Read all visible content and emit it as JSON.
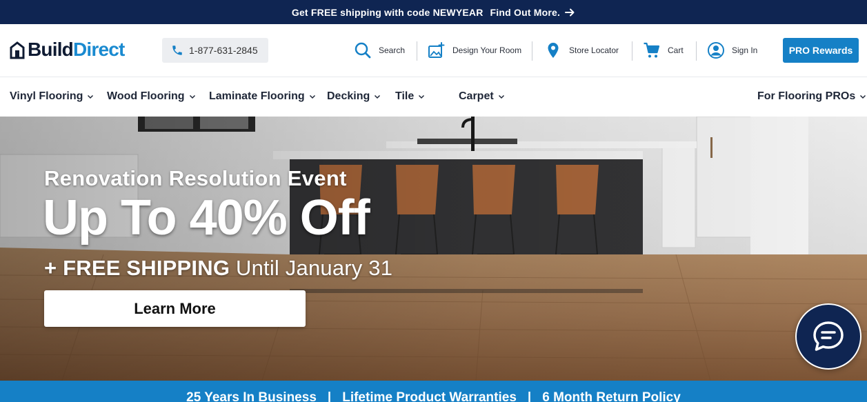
{
  "promo_bar": {
    "message": "Get FREE shipping with code NEWYEAR",
    "link_label": "Find Out More."
  },
  "header": {
    "logo": {
      "part1": "Build",
      "part2": "Direct"
    },
    "phone": "1-877-631-2845",
    "utilities": {
      "search": "Search",
      "design": "Design Your Room",
      "store": "Store Locator",
      "cart": "Cart",
      "signin": "Sign In"
    },
    "pro_button": "PRO Rewards"
  },
  "nav": {
    "items": [
      {
        "label": "Vinyl Flooring"
      },
      {
        "label": "Wood Flooring"
      },
      {
        "label": "Laminate Flooring"
      },
      {
        "label": "Decking"
      },
      {
        "label": "Tile"
      },
      {
        "label": "Carpet"
      },
      {
        "label": "For Flooring PROs"
      }
    ]
  },
  "hero": {
    "eyebrow": "Renovation Resolution Event",
    "headline": "Up To 40% Off",
    "sub_bold": "+ FREE SHIPPING",
    "sub_rest": "Until January 31",
    "button": "Learn More"
  },
  "value_bar": {
    "items": [
      "25 Years In Business",
      "Lifetime Product Warranties",
      "6 Month Return Policy"
    ],
    "separator": "|"
  },
  "colors": {
    "navy": "#0f2552",
    "brand_blue": "#1580c6",
    "logo_blue": "#1a8ad0"
  },
  "icons": {
    "phone": "phone-icon",
    "search": "search-icon",
    "design": "design-room-icon",
    "store": "map-pin-icon",
    "cart": "cart-icon",
    "signin": "user-icon",
    "chat": "chat-icon"
  }
}
